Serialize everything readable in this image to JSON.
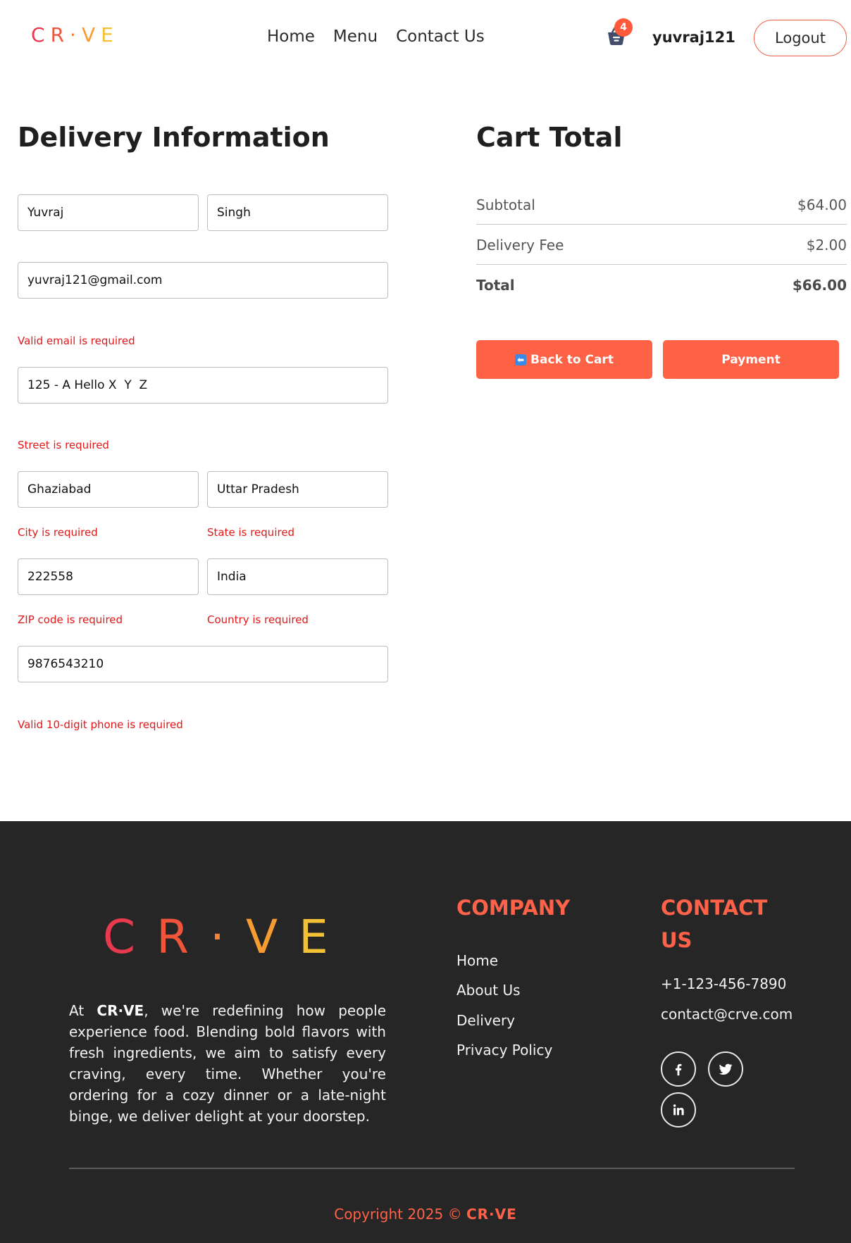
{
  "header": {
    "logo_letters": [
      "C",
      "R",
      "·",
      "V",
      "E"
    ],
    "nav": [
      "Home",
      "Menu",
      "Contact Us"
    ],
    "cart_count": "4",
    "username": "yuvraj121",
    "logout_label": "Logout"
  },
  "delivery": {
    "title": "Delivery Information",
    "first_name": "Yuvraj",
    "last_name": "Singh",
    "email": "yuvraj121@gmail.com",
    "email_error": "Valid email is required",
    "street": "125 - A Hello X  Y  Z",
    "street_error": "Street is required",
    "city": "Ghaziabad",
    "city_error": "City is required",
    "state": "Uttar Pradesh",
    "state_error": "State is required",
    "zip": "222558",
    "zip_error": "ZIP code is required",
    "country": "India",
    "country_error": "Country is required",
    "phone": "9876543210",
    "phone_error": "Valid 10-digit phone is required"
  },
  "cart_total": {
    "title": "Cart Total",
    "subtotal_label": "Subtotal",
    "subtotal_value": "$64.00",
    "delivery_fee_label": "Delivery Fee",
    "delivery_fee_value": "$2.00",
    "total_label": "Total",
    "total_value": "$66.00",
    "back_label": "Back to Cart",
    "back_icon": "arrow-left-icon",
    "payment_label": "Payment"
  },
  "footer": {
    "logo_letters": [
      "C",
      "R",
      "·",
      "V",
      "E"
    ],
    "about_prefix": "At",
    "about_brand": "CR·VE",
    "about_text": ", we're redefining how people experience food. Blending bold flavors with fresh ingredients, we aim to satisfy every craving, every time. Whether you're ordering for a cozy dinner or a late-night binge, we deliver delight at your doorstep.",
    "company_heading": "COMPANY",
    "company_links": [
      "Home",
      "About Us",
      "Delivery",
      "Privacy Policy"
    ],
    "contact_heading_line1": "CONTACT",
    "contact_heading_line2": "US",
    "phone": "+1-123-456-7890",
    "email": "contact@crve.com",
    "social_icons": [
      "facebook-icon",
      "twitter-icon",
      "linkedin-icon"
    ],
    "copyright_prefix": "Copyright 2025 ©",
    "copyright_brand": "CR·VE"
  },
  "colors": {
    "accent": "#fd6246",
    "error": "#e21818",
    "footer_bg": "#262626",
    "logo_gradient": [
      "#e8394f",
      "#f1543a",
      "#f5823a",
      "#f79c30",
      "#f4c034"
    ]
  }
}
